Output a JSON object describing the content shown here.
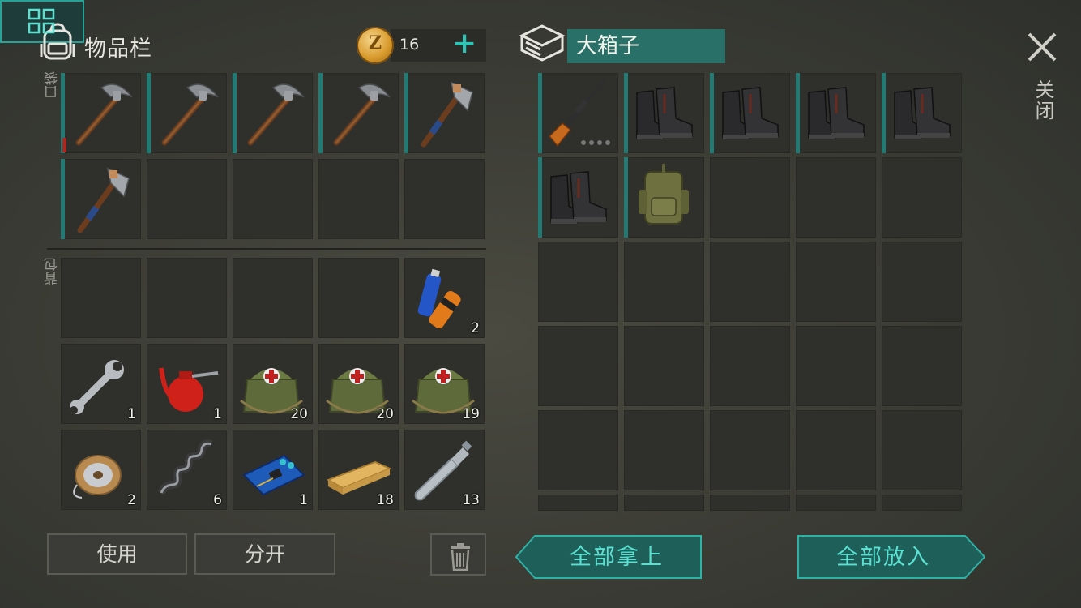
{
  "inventory": {
    "title": "物品栏",
    "coins": "16",
    "coin_letter": "Z",
    "pocket_label": "口袋",
    "backpack_label": "背包",
    "pockets": [
      {
        "item": "pickaxe",
        "count": ""
      },
      {
        "item": "pickaxe",
        "count": ""
      },
      {
        "item": "pickaxe",
        "count": ""
      },
      {
        "item": "pickaxe",
        "count": ""
      },
      {
        "item": "hatchet",
        "count": ""
      },
      {
        "item": "hatchet",
        "count": ""
      },
      {
        "item": "",
        "count": ""
      },
      {
        "item": "",
        "count": ""
      },
      {
        "item": "",
        "count": ""
      },
      {
        "item": "",
        "count": ""
      }
    ],
    "backpack": [
      {
        "item": "",
        "count": ""
      },
      {
        "item": "",
        "count": ""
      },
      {
        "item": "",
        "count": ""
      },
      {
        "item": "",
        "count": ""
      },
      {
        "item": "batteries",
        "count": "2"
      },
      {
        "item": "wrench",
        "count": "1"
      },
      {
        "item": "oil-can",
        "count": "1"
      },
      {
        "item": "medkit-bag",
        "count": "20"
      },
      {
        "item": "medkit-bag",
        "count": "20"
      },
      {
        "item": "medkit-bag",
        "count": "19"
      },
      {
        "item": "wire-spool",
        "count": "2"
      },
      {
        "item": "spring",
        "count": "6"
      },
      {
        "item": "circuit-board",
        "count": "1"
      },
      {
        "item": "wooden-plank",
        "count": "18"
      },
      {
        "item": "plastic-bottle",
        "count": "13"
      }
    ]
  },
  "container": {
    "name": "大箱子",
    "close_label": "关闭",
    "slots": [
      {
        "item": "rifle",
        "count": ""
      },
      {
        "item": "boots",
        "count": ""
      },
      {
        "item": "boots",
        "count": ""
      },
      {
        "item": "boots",
        "count": ""
      },
      {
        "item": "boots",
        "count": ""
      },
      {
        "item": "boots",
        "count": ""
      },
      {
        "item": "military-backpack",
        "count": ""
      }
    ]
  },
  "actions": {
    "use": "使用",
    "split": "分开",
    "take_all": "全部拿上",
    "put_all": "全部放入"
  },
  "colors": {
    "accent": "#2ec3b5",
    "slot_marker": "#217a74",
    "button_teal": "#1e5f5a"
  }
}
